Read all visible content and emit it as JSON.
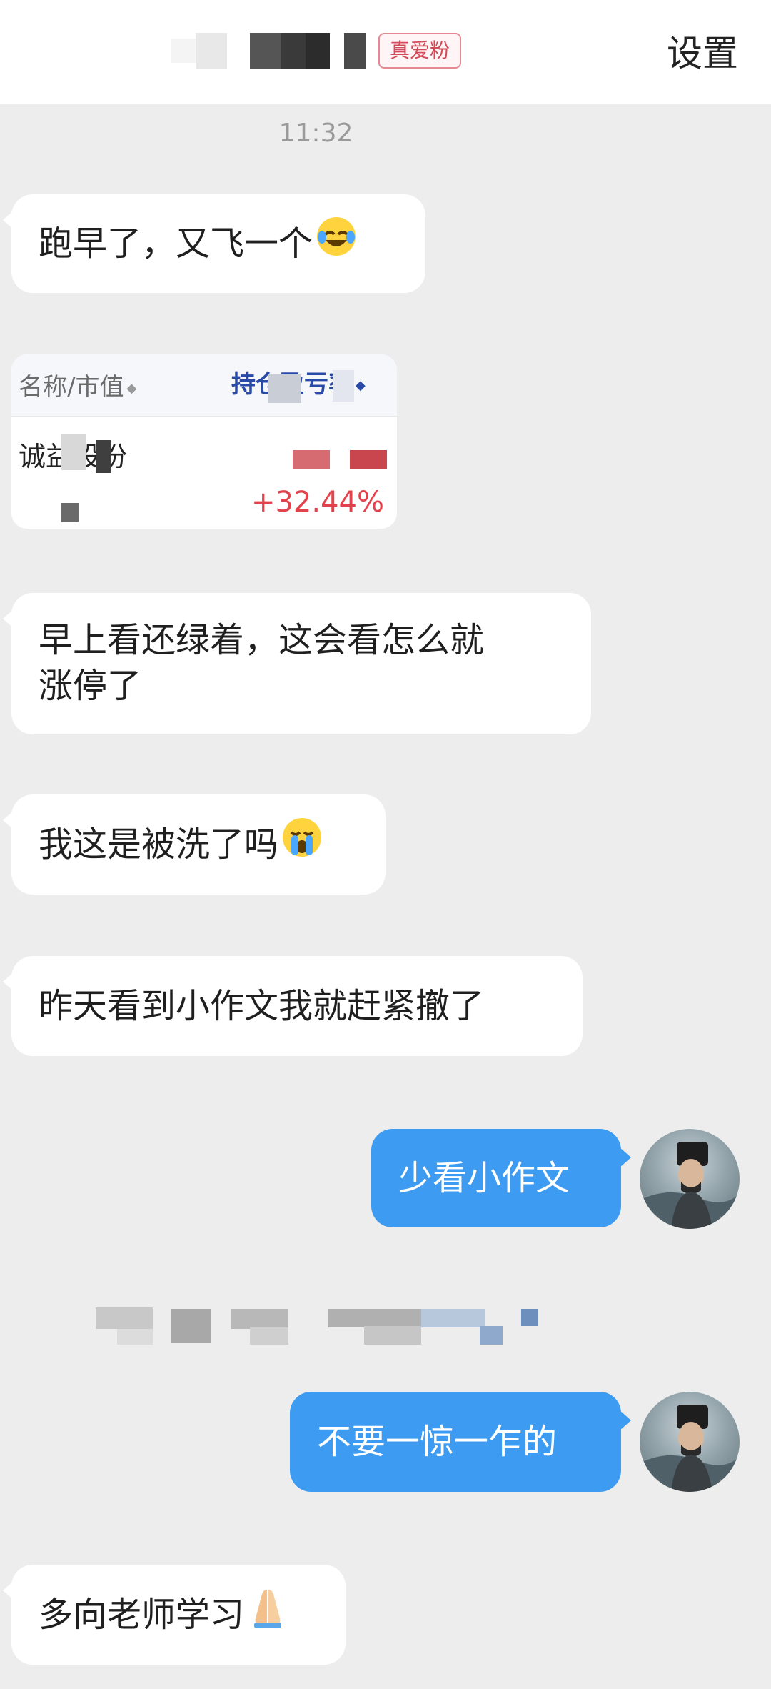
{
  "header": {
    "badge": "真爱粉",
    "settings_label": "设置"
  },
  "time": "11:32",
  "messages": [
    {
      "side": "left",
      "text": "跑早了，又飞一个",
      "emoji": "laugh-crying"
    },
    {
      "side": "left",
      "text": "早上看还绿着，这会看怎么就",
      "text2": "涨停了"
    },
    {
      "side": "left",
      "text": "我这是被洗了吗",
      "emoji": "crying"
    },
    {
      "side": "left",
      "text": "昨天看到小作文我就赶紧撤了"
    },
    {
      "side": "right",
      "text": "少看小作文"
    },
    {
      "side": "right",
      "text": "不要一惊一乍的"
    },
    {
      "side": "left",
      "text": "多向老师学习",
      "emoji": "folded-hands"
    }
  ],
  "stock_card": {
    "col_name_label": "名称/市值",
    "col_gain_label": "持仓盈亏率",
    "stock_name": "诚益股份",
    "gain_pct": "+32.44%"
  },
  "colors": {
    "background": "#ededed",
    "bubble_left": "#ffffff",
    "bubble_right": "#3d9bf2",
    "gain_red": "#e2424b",
    "badge_red": "#d24b58"
  }
}
